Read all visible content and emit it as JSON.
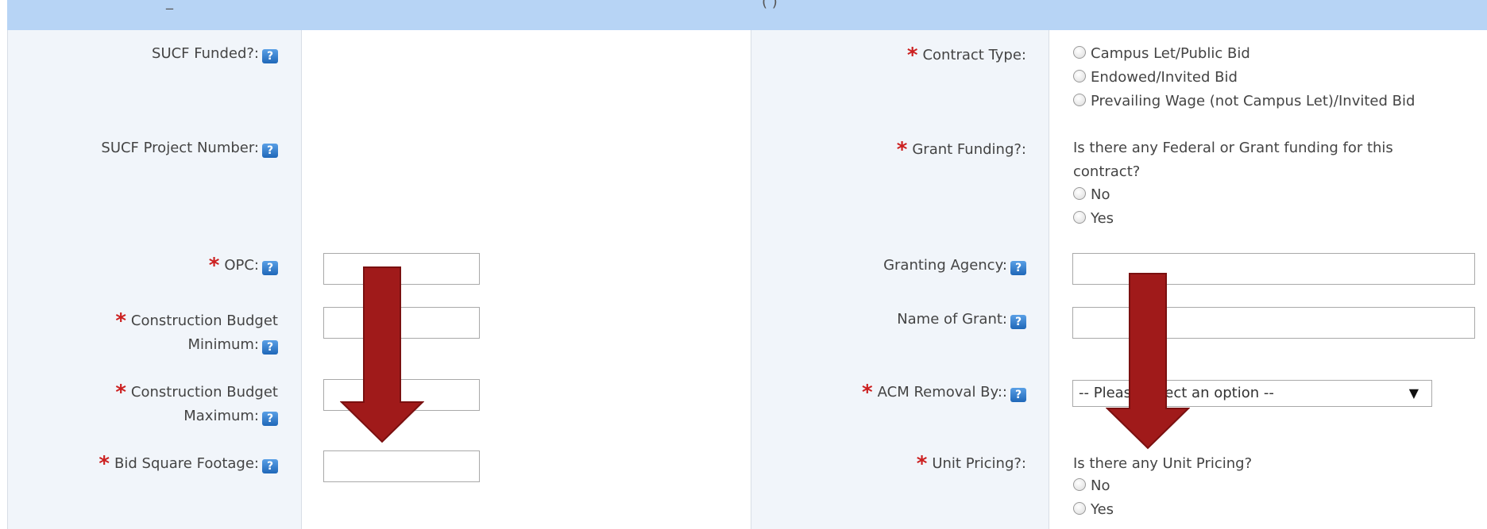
{
  "header": {
    "partial_left": "_",
    "partial_center": "(                )"
  },
  "help_glyph": "?",
  "required_glyph": "*",
  "left": {
    "sucf_funded": {
      "label": "SUCF Funded?:"
    },
    "sucf_project_number": {
      "label": "SUCF Project Number:"
    },
    "opc": {
      "label": "OPC:",
      "value": ""
    },
    "budget_min": {
      "label_line1": "Construction Budget",
      "label_line2": "Minimum:",
      "value": ""
    },
    "budget_max": {
      "label_line1": "Construction Budget",
      "label_line2": "Maximum:",
      "value": ""
    },
    "bid_sqft": {
      "label": "Bid Square Footage:",
      "value": ""
    }
  },
  "right": {
    "contract_type": {
      "label": "Contract Type:",
      "options": [
        "Campus Let/Public Bid",
        "Endowed/Invited Bid",
        "Prevailing Wage (not Campus Let)/Invited Bid"
      ]
    },
    "grant_funding": {
      "label": "Grant Funding?:",
      "question_line1": "Is there any Federal or Grant funding for this",
      "question_line2": "contract?",
      "options": [
        "No",
        "Yes"
      ]
    },
    "granting_agency": {
      "label": "Granting Agency:",
      "value": ""
    },
    "name_of_grant": {
      "label": "Name of Grant:",
      "value": ""
    },
    "acm_removal": {
      "label": "ACM Removal By::",
      "selected": "-- Please select an option --"
    },
    "unit_pricing": {
      "label": "Unit Pricing?:",
      "question": "Is there any Unit Pricing?",
      "options": [
        "No",
        "Yes"
      ]
    }
  },
  "colors": {
    "header_band": "#b7d4f5",
    "label_column": "#f1f5fa",
    "required": "#cc1f1f",
    "annotation_arrow": "#a01a1a"
  },
  "icons": [
    "help-icon",
    "radio-icon",
    "dropdown-caret-icon",
    "annotation-arrow"
  ]
}
